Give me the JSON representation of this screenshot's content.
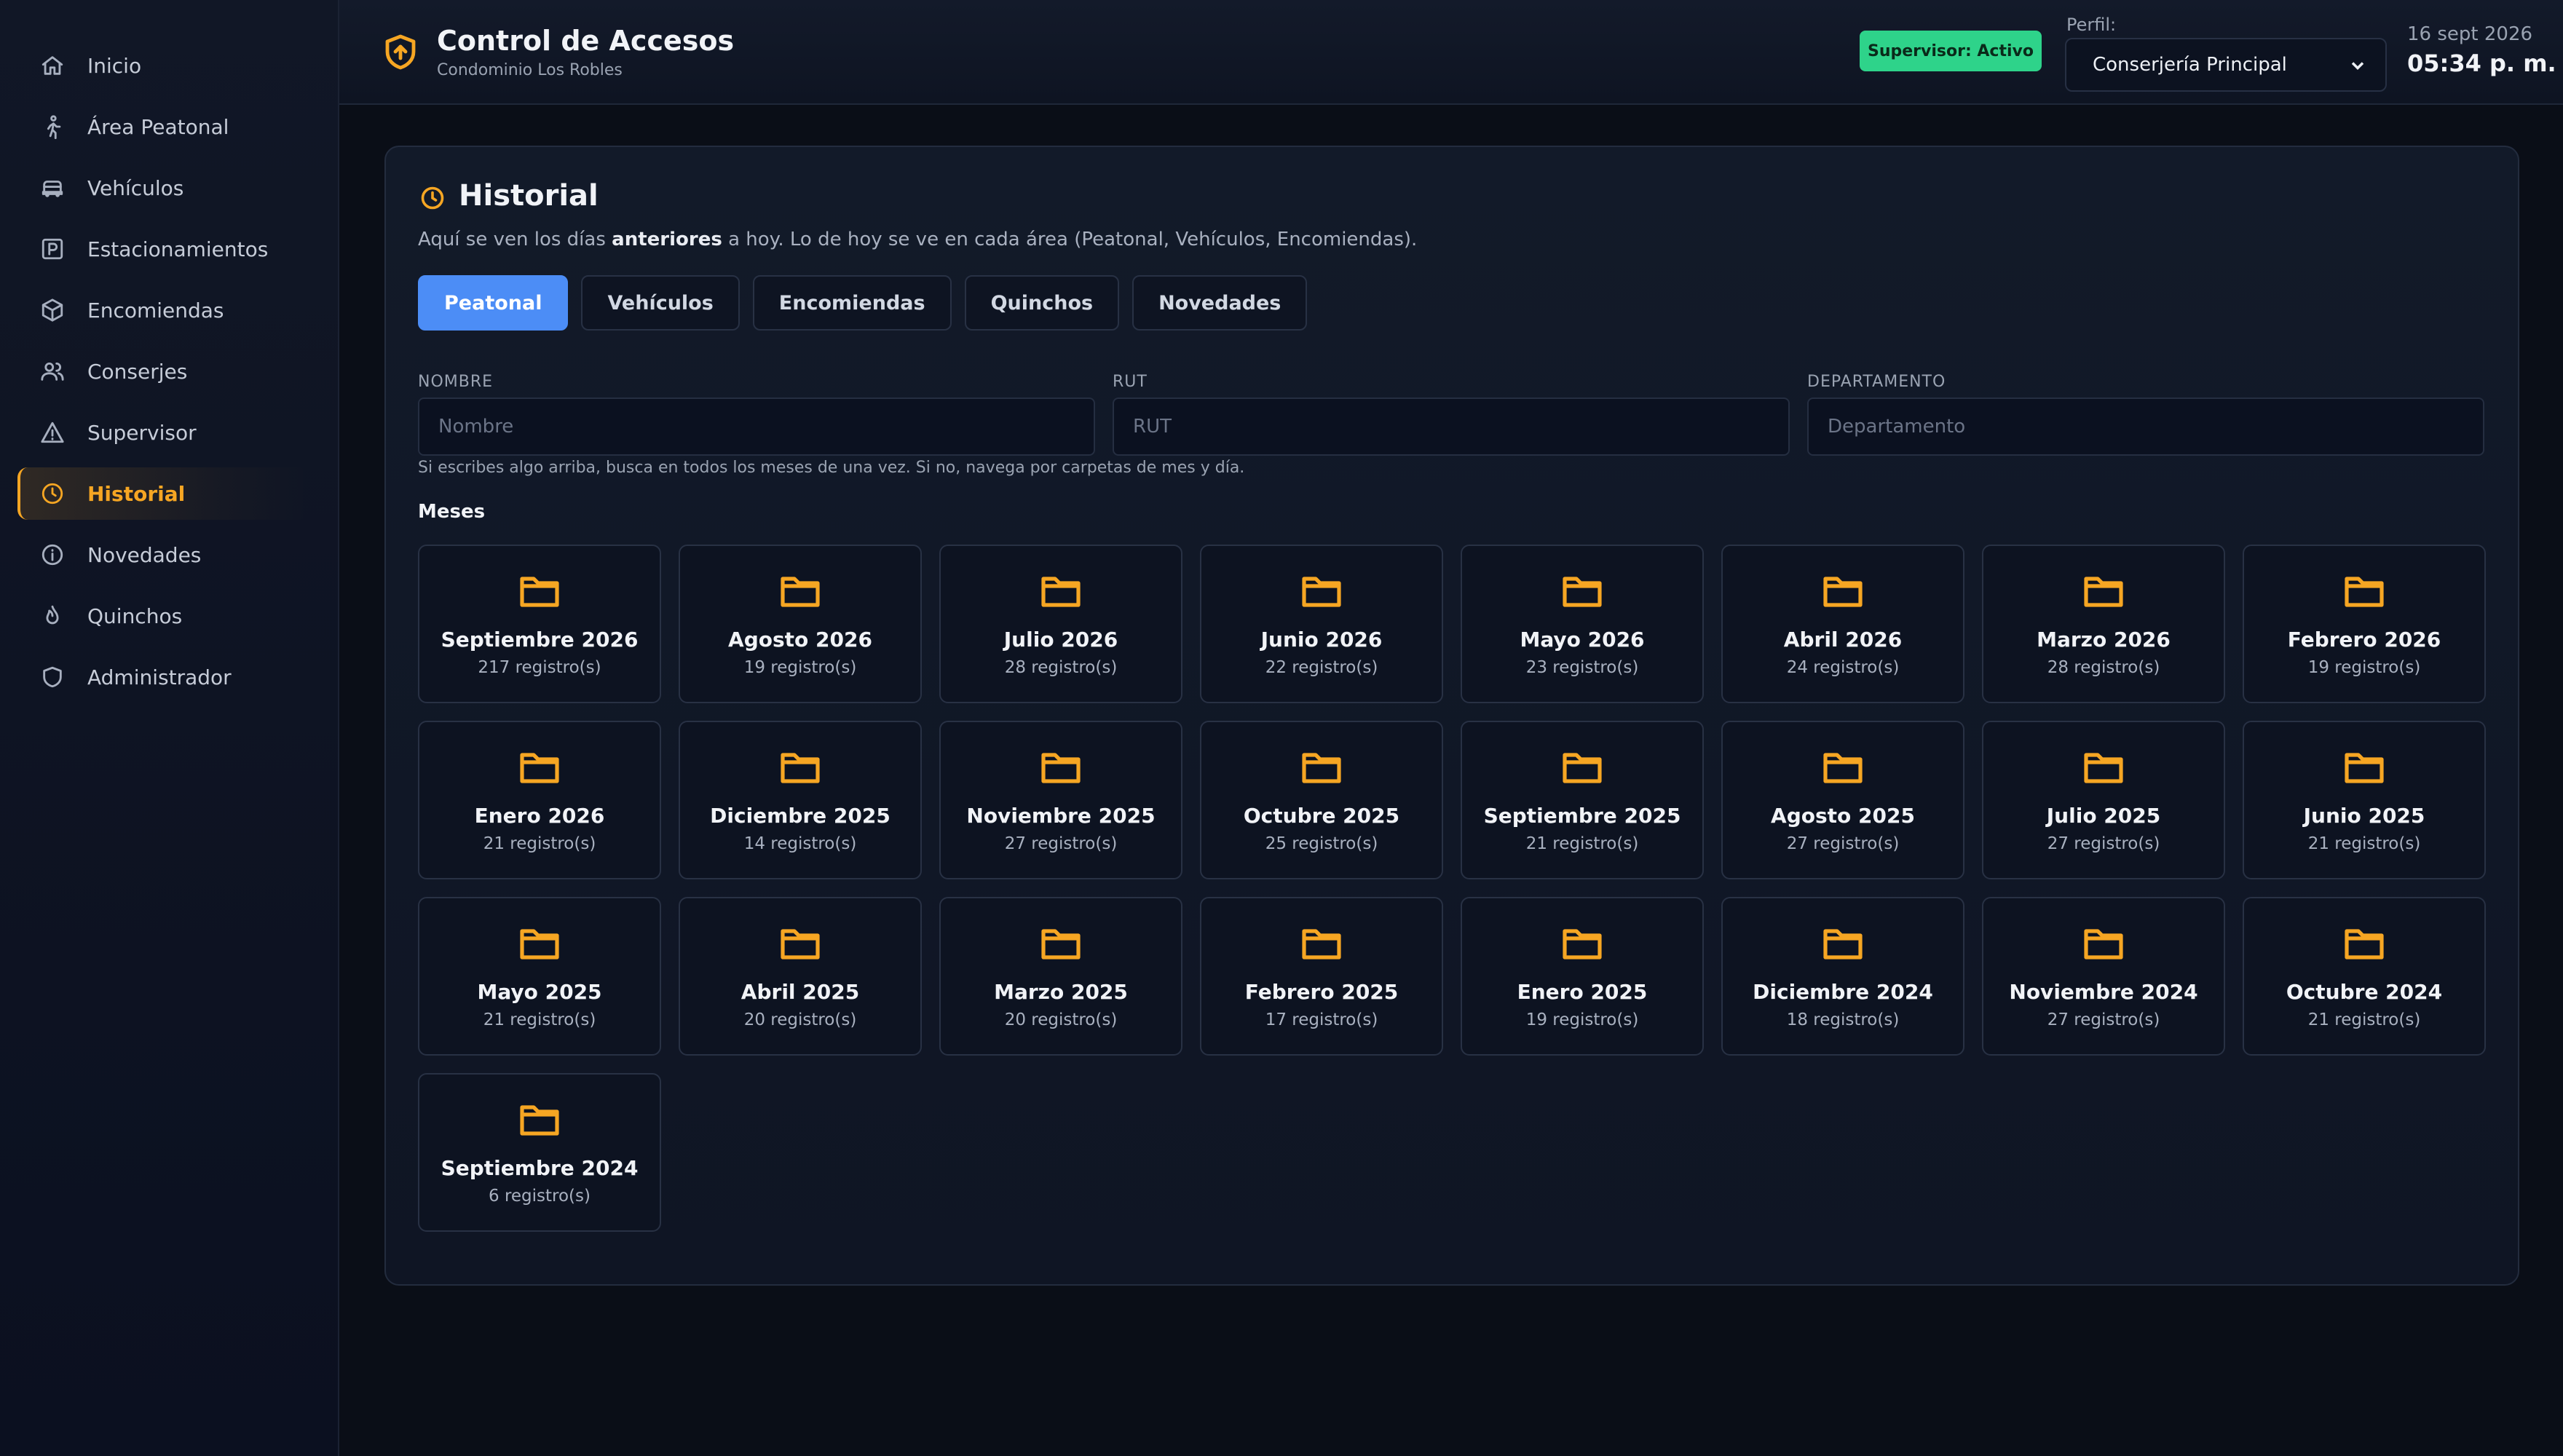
{
  "sidebar": {
    "items": [
      {
        "label": "Inicio",
        "icon": "home-icon"
      },
      {
        "label": "Área Peatonal",
        "icon": "walking-icon"
      },
      {
        "label": "Vehículos",
        "icon": "car-icon"
      },
      {
        "label": "Estacionamientos",
        "icon": "parking-icon"
      },
      {
        "label": "Encomiendas",
        "icon": "package-icon"
      },
      {
        "label": "Conserjes",
        "icon": "users-icon"
      },
      {
        "label": "Supervisor",
        "icon": "warning-icon"
      },
      {
        "label": "Historial",
        "icon": "clock-icon",
        "active": true
      },
      {
        "label": "Novedades",
        "icon": "info-icon"
      },
      {
        "label": "Quinchos",
        "icon": "flame-icon"
      },
      {
        "label": "Administrador",
        "icon": "shield-icon"
      }
    ]
  },
  "header": {
    "title": "Control de Accesos",
    "subtitle": "Condominio Los Robles",
    "badge": "Supervisor: Activo",
    "profile_label": "Perfil:",
    "profile_value": "Conserjería Principal",
    "date": "16 sept 2026",
    "time": "05:34 p. m."
  },
  "historial": {
    "title": "Historial",
    "desc_pre": "Aquí se ven los días ",
    "desc_bold": "anteriores",
    "desc_post": " a hoy. Lo de hoy se ve en cada área (Peatonal, Vehículos, Encomiendas).",
    "tabs": [
      "Peatonal",
      "Vehículos",
      "Encomiendas",
      "Quinchos",
      "Novedades"
    ],
    "active_tab": "Peatonal",
    "fields": {
      "nombre": {
        "label": "NOMBRE",
        "placeholder": "Nombre"
      },
      "rut": {
        "label": "RUT",
        "placeholder": "RUT"
      },
      "departamento": {
        "label": "DEPARTAMENTO",
        "placeholder": "Departamento"
      }
    },
    "hint": "Si escribes algo arriba, busca en todos los meses de una vez. Si no, navega por carpetas de mes y día.",
    "months_title": "Meses",
    "months": [
      {
        "name": "Septiembre 2026",
        "count": "217 registro(s)"
      },
      {
        "name": "Agosto 2026",
        "count": "19 registro(s)"
      },
      {
        "name": "Julio 2026",
        "count": "28 registro(s)"
      },
      {
        "name": "Junio 2026",
        "count": "22 registro(s)"
      },
      {
        "name": "Mayo 2026",
        "count": "23 registro(s)"
      },
      {
        "name": "Abril 2026",
        "count": "24 registro(s)"
      },
      {
        "name": "Marzo 2026",
        "count": "28 registro(s)"
      },
      {
        "name": "Febrero 2026",
        "count": "19 registro(s)"
      },
      {
        "name": "Enero 2026",
        "count": "21 registro(s)"
      },
      {
        "name": "Diciembre 2025",
        "count": "14 registro(s)"
      },
      {
        "name": "Noviembre 2025",
        "count": "27 registro(s)"
      },
      {
        "name": "Octubre 2025",
        "count": "25 registro(s)"
      },
      {
        "name": "Septiembre 2025",
        "count": "21 registro(s)"
      },
      {
        "name": "Agosto 2025",
        "count": "27 registro(s)"
      },
      {
        "name": "Julio 2025",
        "count": "27 registro(s)"
      },
      {
        "name": "Junio 2025",
        "count": "21 registro(s)"
      },
      {
        "name": "Mayo 2025",
        "count": "21 registro(s)"
      },
      {
        "name": "Abril 2025",
        "count": "20 registro(s)"
      },
      {
        "name": "Marzo 2025",
        "count": "20 registro(s)"
      },
      {
        "name": "Febrero 2025",
        "count": "17 registro(s)"
      },
      {
        "name": "Enero 2025",
        "count": "19 registro(s)"
      },
      {
        "name": "Diciembre 2024",
        "count": "18 registro(s)"
      },
      {
        "name": "Noviembre 2024",
        "count": "27 registro(s)"
      },
      {
        "name": "Octubre 2024",
        "count": "21 registro(s)"
      },
      {
        "name": "Septiembre 2024",
        "count": "6 registro(s)"
      }
    ]
  },
  "colors": {
    "accent": "#f6a623",
    "primary": "#4c8df6",
    "success": "#2ed38a"
  }
}
